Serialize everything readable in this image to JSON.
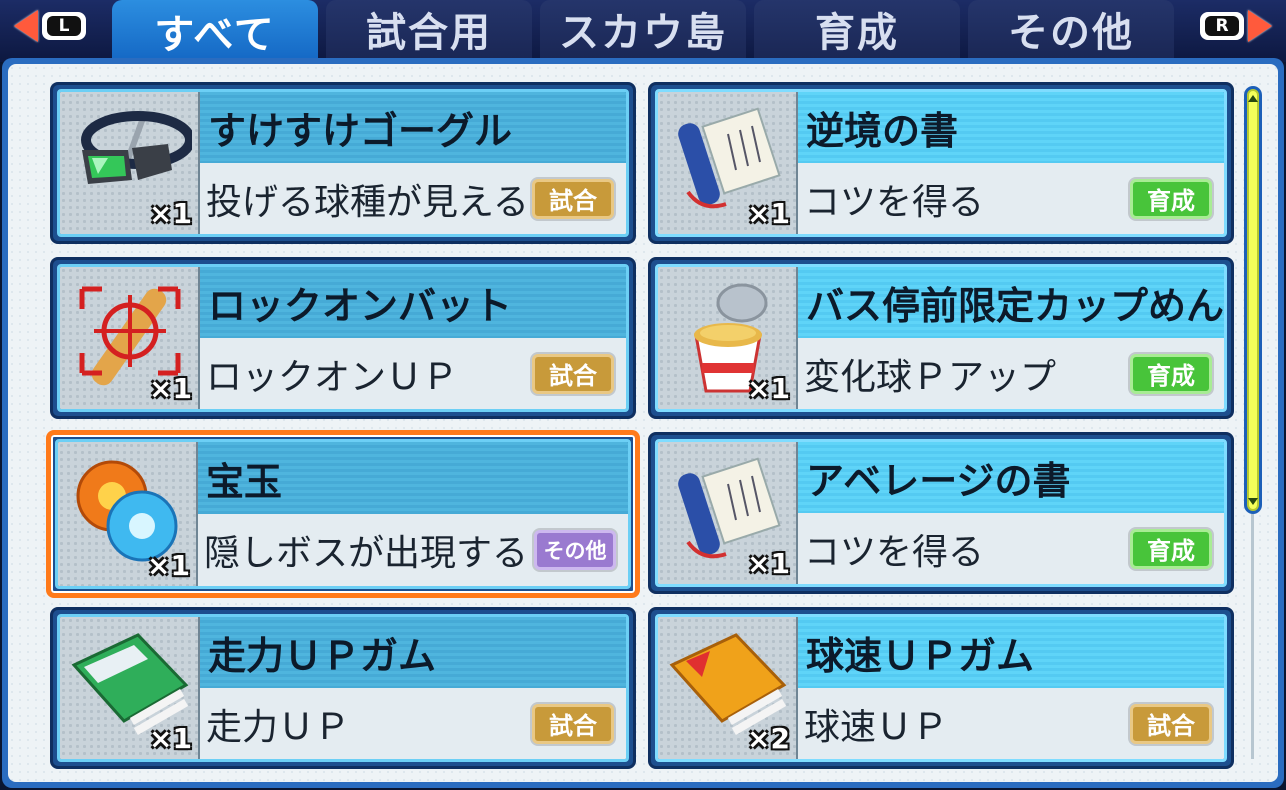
{
  "controls": {
    "left_key": "L",
    "right_key": "R"
  },
  "tabs": [
    {
      "label": "すべて",
      "active": true
    },
    {
      "label": "試合用",
      "active": false
    },
    {
      "label": "スカウ島",
      "active": false
    },
    {
      "label": "育成",
      "active": false
    },
    {
      "label": "その他",
      "active": false
    }
  ],
  "items": [
    {
      "name": "すけすけゴーグル",
      "desc": "投げる球種が見える",
      "badge": "試合",
      "badge_type": "match",
      "qty": "×1",
      "icon": "goggles-icon"
    },
    {
      "name": "逆境の書",
      "desc": "コツを得る",
      "badge": "育成",
      "badge_type": "train",
      "qty": "×1",
      "icon": "scroll-icon"
    },
    {
      "name": "ロックオンバット",
      "desc": "ロックオンＵＰ",
      "badge": "試合",
      "badge_type": "match",
      "qty": "×1",
      "icon": "bat-icon"
    },
    {
      "name": "バス停前限定カップめん",
      "desc": "変化球Ｐアップ",
      "badge": "育成",
      "badge_type": "train",
      "qty": "×1",
      "icon": "cup-noodle-icon"
    },
    {
      "name": "宝玉",
      "desc": "隠しボスが出現する",
      "badge": "その他",
      "badge_type": "other",
      "qty": "×1",
      "icon": "orbs-icon",
      "selected": true
    },
    {
      "name": "アベレージの書",
      "desc": "コツを得る",
      "badge": "育成",
      "badge_type": "train",
      "qty": "×1",
      "icon": "scroll-icon"
    },
    {
      "name": "走力ＵＰガム",
      "desc": "走力ＵＰ",
      "badge": "試合",
      "badge_type": "match",
      "qty": "×1",
      "icon": "gum-green-icon"
    },
    {
      "name": "球速ＵＰガム",
      "desc": "球速ＵＰ",
      "badge": "試合",
      "badge_type": "match",
      "qty": "×2",
      "icon": "gum-orange-icon"
    }
  ],
  "colors": {
    "tab_active": "#1f7fd8",
    "selection": "#ff7a1a",
    "badge_match": "#c89a3a",
    "badge_train": "#48c43a",
    "badge_other": "#9a7ad0",
    "scrollbar_thumb": "#f4ff5a"
  }
}
